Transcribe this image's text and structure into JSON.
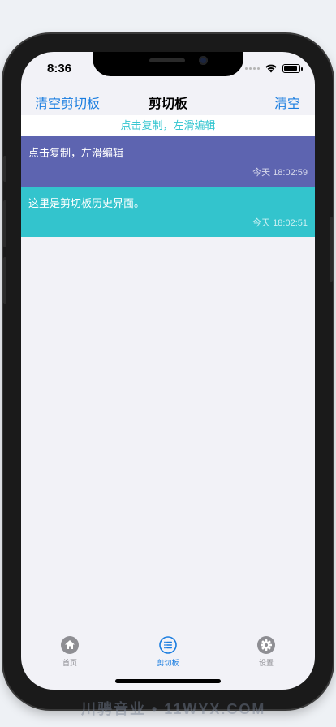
{
  "status_bar": {
    "time": "8:36"
  },
  "nav": {
    "left_button": "清空剪切板",
    "title": "剪切板",
    "right_button": "清空"
  },
  "hint": "点击复制，左滑编辑",
  "clips": [
    {
      "text": "点击复制，左滑编辑",
      "time": "今天 18:02:59",
      "color": "#5d64b0"
    },
    {
      "text": "这里是剪切板历史界面。",
      "time": "今天 18:02:51",
      "color": "#33c4cd"
    }
  ],
  "tabs": [
    {
      "label": "首页",
      "icon": "home-icon"
    },
    {
      "label": "剪切板",
      "icon": "list-icon"
    },
    {
      "label": "设置",
      "icon": "gear-icon"
    }
  ],
  "colors": {
    "accent": "#1a7de0",
    "hint": "#35c6d0",
    "inactive": "#8e8e93"
  },
  "watermark": "川骋音业 • 11WYX.COM"
}
